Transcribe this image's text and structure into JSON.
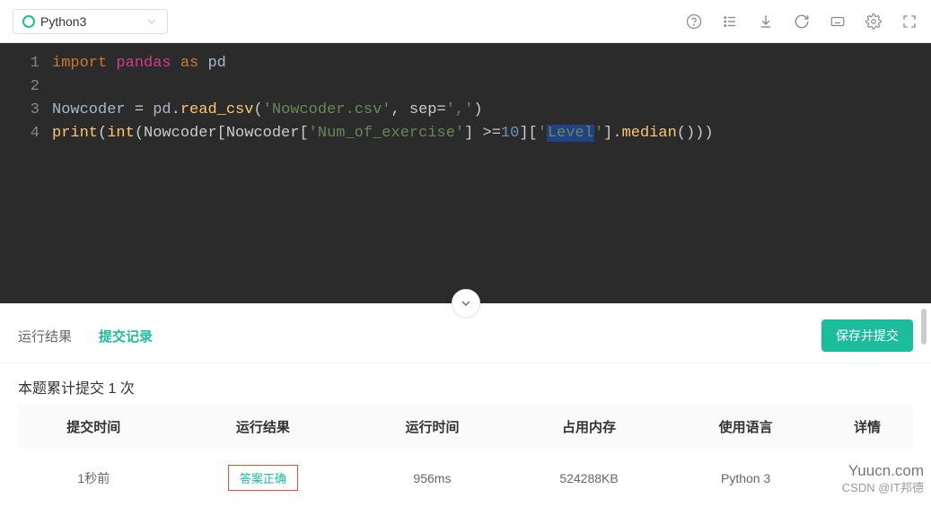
{
  "toolbar": {
    "language": "Python3"
  },
  "code": {
    "line1_import": "import",
    "line1_pandas": "pandas",
    "line1_as": "as",
    "line1_pd": "pd",
    "line3_var": "Nowcoder ",
    "line3_eq": "=",
    "line3_pd": " pd",
    "line3_dot": ".",
    "line3_fn": "read_csv",
    "line3_open": "(",
    "line3_str1": "'Nowcoder.csv'",
    "line3_comma": ", sep=",
    "line3_str2": "','",
    "line3_close": ")",
    "line4_fn1": "print",
    "line4_op1": "(",
    "line4_fn2": "int",
    "line4_op2": "(Nowcoder[Nowcoder[",
    "line4_str1": "'Num_of_exercise'",
    "line4_op3": "] >=",
    "line4_num": "10",
    "line4_op4": "][",
    "line4_str2_q1": "'",
    "line4_str2_mid": "Level",
    "line4_str2_q2": "'",
    "line4_op5": "].",
    "line4_fn3": "median",
    "line4_op6": "()))"
  },
  "tabs": {
    "run_result": "运行结果",
    "submit_record": "提交记录",
    "submit_button": "保存并提交"
  },
  "summary": "本题累计提交 1 次",
  "table": {
    "headers": {
      "time": "提交时间",
      "result": "运行结果",
      "runtime": "运行时间",
      "memory": "占用内存",
      "language": "使用语言",
      "detail": "详情"
    },
    "row": {
      "time": "1秒前",
      "result": "答案正确",
      "runtime": "956ms",
      "memory": "524288KB",
      "language": "Python 3",
      "detail": ""
    }
  },
  "watermark": {
    "main": "Yuucn.com",
    "sub": "CSDN @IT邦德"
  }
}
